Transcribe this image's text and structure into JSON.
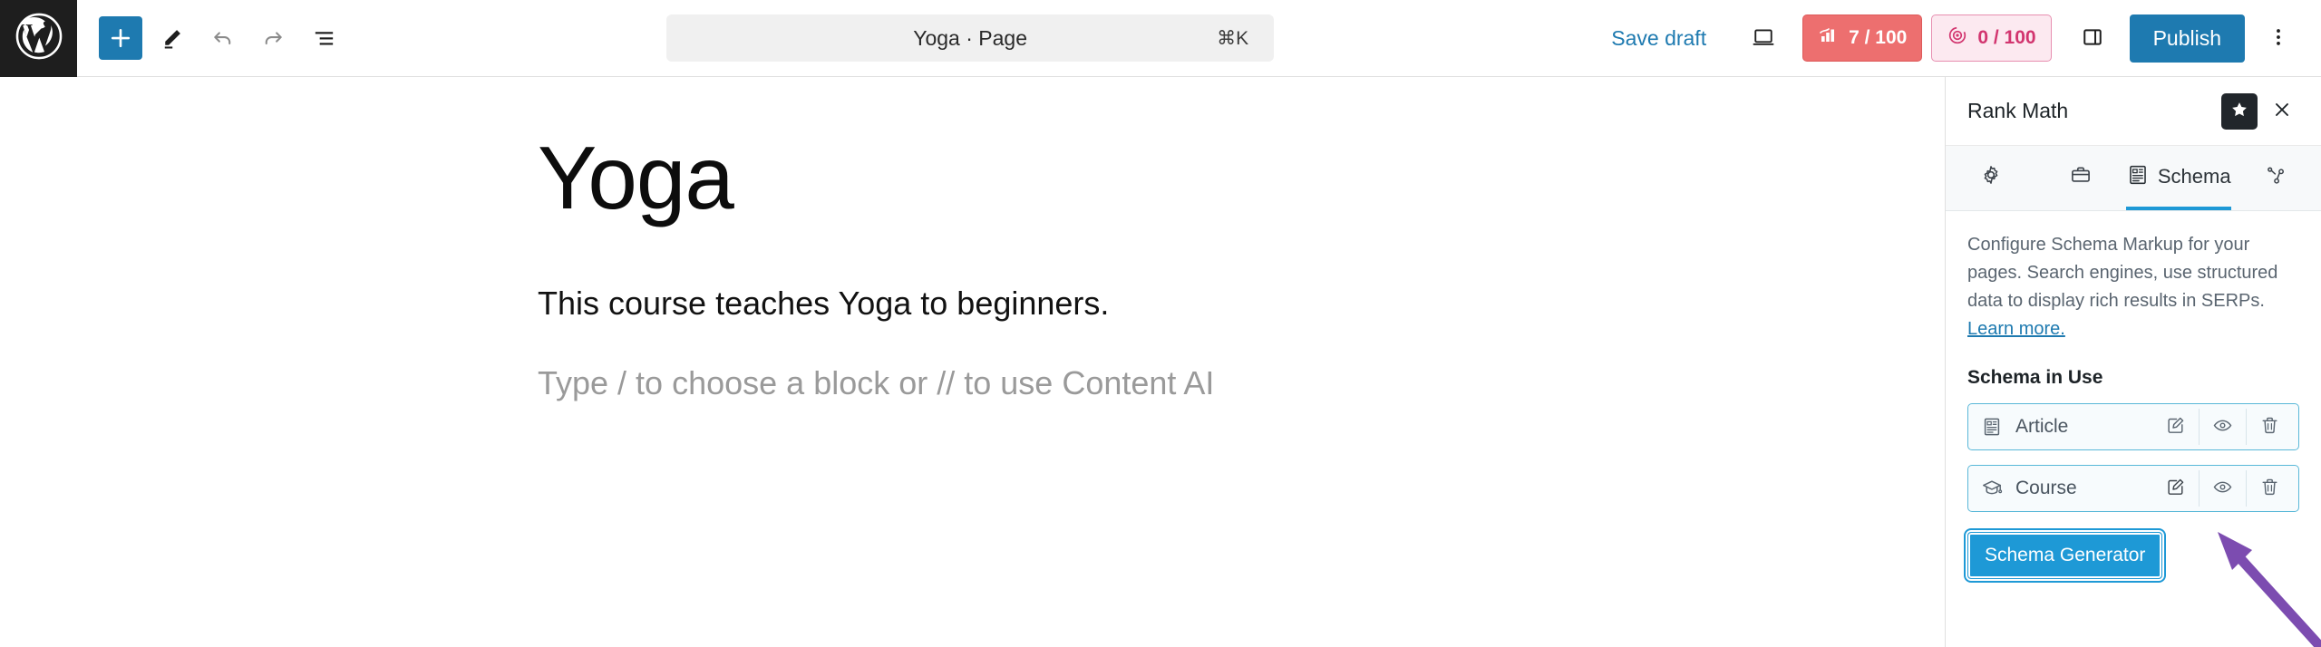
{
  "topbar": {
    "logo_icon": "wordpress-logo-icon",
    "left_tools": [
      {
        "name": "add-block-button",
        "icon": "plus-icon"
      },
      {
        "name": "tools-button",
        "icon": "pencil-icon"
      },
      {
        "name": "undo-button",
        "icon": "undo-arrow-icon"
      },
      {
        "name": "redo-button",
        "icon": "redo-arrow-icon"
      },
      {
        "name": "document-overview-button",
        "icon": "list-view-icon"
      }
    ],
    "command_bar": {
      "title": "Yoga · Page",
      "shortcut": "⌘K"
    },
    "save_draft_label": "Save draft",
    "view_icon": "desktop-view-icon",
    "seo_score": {
      "icon": "seo-bars-icon",
      "value": "7 / 100",
      "bg_color": "#ed6f6f",
      "text_color": "#ffffff"
    },
    "content_ai_score": {
      "icon": "content-ai-icon",
      "value": "0 / 100",
      "bg_color": "#fce9f0",
      "text_color": "#d2356f"
    },
    "sidebar_toggle_icon": "sidebar-panel-icon",
    "publish_label": "Publish",
    "options_icon": "kebab-menu-icon"
  },
  "editor": {
    "title": "Yoga",
    "paragraph": "This course teaches Yoga to beginners.",
    "placeholder": "Type / to choose a block or // to use Content AI"
  },
  "rank_math": {
    "panel_title": "Rank Math",
    "star_icon": "star-icon",
    "close_icon": "close-icon",
    "tabs": [
      {
        "label": "",
        "icon": "gear-icon",
        "active": false
      },
      {
        "label": "",
        "icon": "briefcase-icon",
        "active": false
      },
      {
        "label": "Schema",
        "icon": "schema-doc-icon",
        "active": true
      },
      {
        "label": "",
        "icon": "social-share-icon",
        "active": false
      }
    ],
    "description": "Configure Schema Markup for your pages. Search engines, use structured data to display rich results in SERPs.",
    "learn_more_label": "Learn more.",
    "section_title": "Schema in Use",
    "schemas": [
      {
        "name": "Article",
        "icon": "article-doc-icon",
        "actions": [
          {
            "name": "edit-schema-button",
            "icon": "edit-pencil-square-icon"
          },
          {
            "name": "preview-schema-button",
            "icon": "eye-icon"
          },
          {
            "name": "delete-schema-button",
            "icon": "trash-icon"
          }
        ]
      },
      {
        "name": "Course",
        "icon": "graduation-cap-icon",
        "actions": [
          {
            "name": "edit-schema-button",
            "icon": "edit-pencil-square-icon"
          },
          {
            "name": "preview-schema-button",
            "icon": "eye-icon"
          },
          {
            "name": "delete-schema-button",
            "icon": "trash-icon"
          }
        ]
      }
    ],
    "generator_button_label": "Schema Generator",
    "accent_color": "#1e99d6",
    "row_border_color": "#59b8d8"
  },
  "annotation": {
    "arrow_color": "#7c4cb0",
    "points_to": "edit-schema-button-course"
  }
}
